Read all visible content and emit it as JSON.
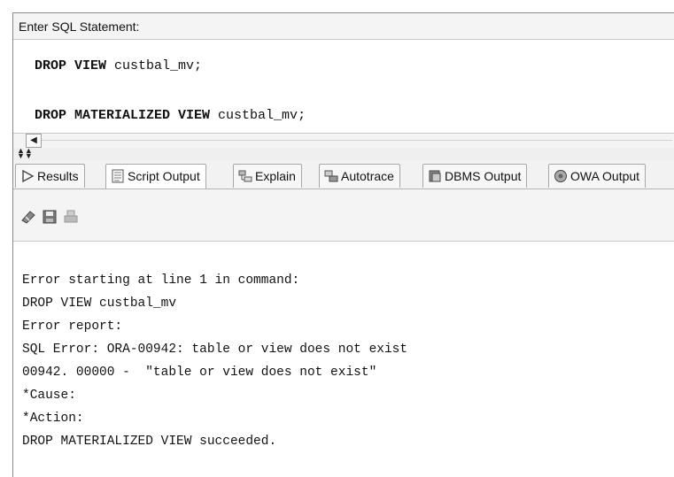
{
  "sql_panel": {
    "label": "Enter SQL Statement:",
    "lines": [
      {
        "kw": "DROP VIEW",
        "rest": " custbal_mv;"
      },
      {
        "kw": "DROP MATERIALIZED VIEW",
        "rest": " custbal_mv;"
      }
    ]
  },
  "tabs": [
    {
      "label": "Results",
      "icon": "play-arrow-icon"
    },
    {
      "label": "Script Output",
      "icon": "script-output-icon"
    },
    {
      "label": "Explain",
      "icon": "explain-plan-icon"
    },
    {
      "label": "Autotrace",
      "icon": "autotrace-icon"
    },
    {
      "label": "DBMS Output",
      "icon": "dbms-output-icon"
    },
    {
      "label": "OWA Output",
      "icon": "owa-output-icon"
    }
  ],
  "active_tab": "Script Output",
  "toolbar": {
    "icons": [
      "eraser-icon",
      "save-icon",
      "print-icon"
    ]
  },
  "output": {
    "lines": [
      "Error starting at line 1 in command:",
      "DROP VIEW custbal_mv",
      "Error report:",
      "SQL Error: ORA-00942: table or view does not exist",
      "00942. 00000 -  \"table or view does not exist\"",
      "*Cause:",
      "*Action:",
      "DROP MATERIALIZED VIEW succeeded."
    ]
  }
}
